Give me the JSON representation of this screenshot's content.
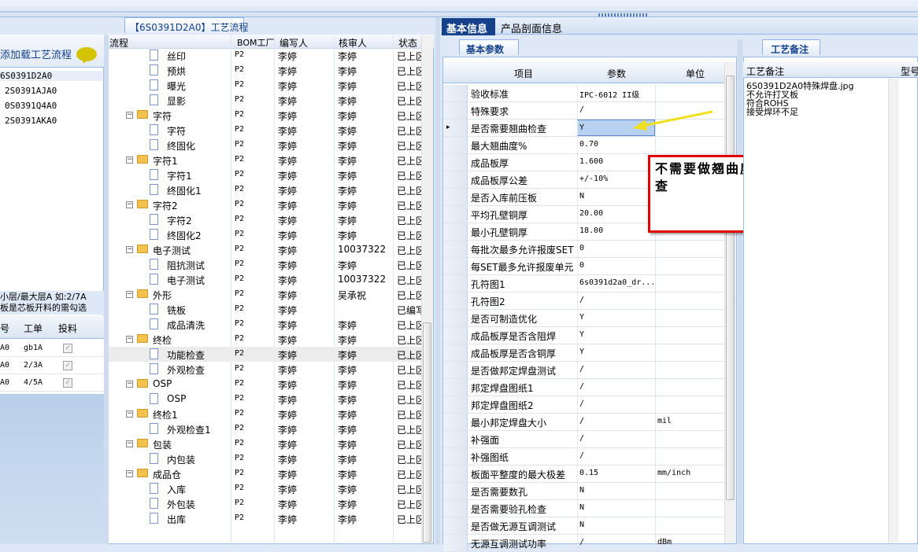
{
  "left": {
    "load_label": "添加载工艺流程",
    "orders": [
      "6S0391D2A0",
      "2S0391AJA0",
      "0S0391Q4A0",
      "2S0391AKA0"
    ],
    "hint_line1": "小层/最大层A 如:2/7A",
    "hint_line2": "板是芯板开料的需勾选",
    "grid_headers": [
      "号",
      "工单",
      "投料"
    ],
    "grid_rows": [
      {
        "no": "A0",
        "order": "gb1A",
        "checked": "✓"
      },
      {
        "no": "A0",
        "order": "2/3A",
        "checked": "✓"
      },
      {
        "no": "A0",
        "order": "4/5A",
        "checked": "✓"
      }
    ]
  },
  "middle": {
    "tab_label": "【6S0391D2A0】工艺流程",
    "headers": [
      "流程",
      "BOM工厂",
      "编写人",
      "核审人",
      "状态"
    ],
    "rows": [
      {
        "name": "丝印",
        "level": 2,
        "bom": "P2",
        "writer": "李婷",
        "reviewer": "李婷",
        "status": "已上区"
      },
      {
        "name": "预烘",
        "level": 2,
        "bom": "P2",
        "writer": "李婷",
        "reviewer": "李婷",
        "status": "已上区"
      },
      {
        "name": "曝光",
        "level": 2,
        "bom": "P2",
        "writer": "李婷",
        "reviewer": "李婷",
        "status": "已上区"
      },
      {
        "name": "显影",
        "level": 2,
        "bom": "P2",
        "writer": "李婷",
        "reviewer": "李婷",
        "status": "已上区"
      },
      {
        "name": "字符",
        "level": 1,
        "bom": "P2",
        "writer": "李婷",
        "reviewer": "李婷",
        "status": "已上区"
      },
      {
        "name": "字符",
        "level": 2,
        "bom": "P2",
        "writer": "李婷",
        "reviewer": "李婷",
        "status": "已上区"
      },
      {
        "name": "终固化",
        "level": 2,
        "bom": "P2",
        "writer": "李婷",
        "reviewer": "李婷",
        "status": "已上区"
      },
      {
        "name": "字符1",
        "level": 1,
        "bom": "P2",
        "writer": "李婷",
        "reviewer": "李婷",
        "status": "已上区"
      },
      {
        "name": "字符1",
        "level": 2,
        "bom": "P2",
        "writer": "李婷",
        "reviewer": "李婷",
        "status": "已上区"
      },
      {
        "name": "终固化1",
        "level": 2,
        "bom": "P2",
        "writer": "李婷",
        "reviewer": "李婷",
        "status": "已上区"
      },
      {
        "name": "字符2",
        "level": 1,
        "bom": "P2",
        "writer": "李婷",
        "reviewer": "李婷",
        "status": "已上区"
      },
      {
        "name": "字符2",
        "level": 2,
        "bom": "P2",
        "writer": "李婷",
        "reviewer": "李婷",
        "status": "已上区"
      },
      {
        "name": "终固化2",
        "level": 2,
        "bom": "P2",
        "writer": "李婷",
        "reviewer": "李婷",
        "status": "已上区"
      },
      {
        "name": "电子测试",
        "level": 1,
        "bom": "P2",
        "writer": "李婷",
        "reviewer": "10037322",
        "status": "已上区"
      },
      {
        "name": "阻抗测试",
        "level": 2,
        "bom": "P2",
        "writer": "李婷",
        "reviewer": "李婷",
        "status": "已上区"
      },
      {
        "name": "电子测试",
        "level": 2,
        "bom": "P2",
        "writer": "李婷",
        "reviewer": "10037322",
        "status": "已上区"
      },
      {
        "name": "外形",
        "level": 1,
        "bom": "P2",
        "writer": "李婷",
        "reviewer": "吴承祝",
        "status": "已上区"
      },
      {
        "name": "铣板",
        "level": 2,
        "bom": "P2",
        "writer": "李婷",
        "reviewer": "",
        "status": "已编写"
      },
      {
        "name": "成品清洗",
        "level": 2,
        "bom": "P2",
        "writer": "李婷",
        "reviewer": "李婷",
        "status": "已上区"
      },
      {
        "name": "终检",
        "level": 1,
        "bom": "P2",
        "writer": "李婷",
        "reviewer": "李婷",
        "status": "已上区"
      },
      {
        "name": "功能检查",
        "level": 2,
        "bom": "P2",
        "writer": "李婷",
        "reviewer": "李婷",
        "status": "已上区"
      },
      {
        "name": "外观检查",
        "level": 2,
        "bom": "P2",
        "writer": "李婷",
        "reviewer": "李婷",
        "status": "已上区"
      },
      {
        "name": "OSP",
        "level": 1,
        "bom": "P2",
        "writer": "李婷",
        "reviewer": "李婷",
        "status": "已上区"
      },
      {
        "name": "OSP",
        "level": 2,
        "bom": "P2",
        "writer": "李婷",
        "reviewer": "李婷",
        "status": "已上区"
      },
      {
        "name": "终检1",
        "level": 1,
        "bom": "P2",
        "writer": "李婷",
        "reviewer": "李婷",
        "status": "已上区"
      },
      {
        "name": "外观检查1",
        "level": 2,
        "bom": "P2",
        "writer": "李婷",
        "reviewer": "李婷",
        "status": "已上区"
      },
      {
        "name": "包装",
        "level": 1,
        "bom": "P2",
        "writer": "李婷",
        "reviewer": "李婷",
        "status": "已上区"
      },
      {
        "name": "内包装",
        "level": 2,
        "bom": "P2",
        "writer": "李婷",
        "reviewer": "李婷",
        "status": "已上区"
      },
      {
        "name": "成品仓",
        "level": 1,
        "bom": "P2",
        "writer": "李婷",
        "reviewer": "李婷",
        "status": "已上区"
      },
      {
        "name": "入库",
        "level": 2,
        "bom": "P2",
        "writer": "李婷",
        "reviewer": "李婷",
        "status": "已上区"
      },
      {
        "name": "外包装",
        "level": 2,
        "bom": "P2",
        "writer": "李婷",
        "reviewer": "李婷",
        "status": "已上区"
      },
      {
        "name": "出库",
        "level": 2,
        "bom": "P2",
        "writer": "李婷",
        "reviewer": "李婷",
        "status": "已上区"
      }
    ]
  },
  "right": {
    "tab_basic": "基本信息",
    "tab_section": "产品剖面信息",
    "subtab": "基本参数",
    "headers": [
      "项目",
      "参数",
      "单位"
    ],
    "rows": [
      {
        "key": "验收标准",
        "val": "IPC-6012 II级",
        "unit": ""
      },
      {
        "key": "特殊要求",
        "val": "/",
        "unit": ""
      },
      {
        "key": "是否需要翘曲检查",
        "val": "Y",
        "unit": ""
      },
      {
        "key": "最大翘曲度%",
        "val": "0.70",
        "unit": ""
      },
      {
        "key": "成品板厚",
        "val": "1.600",
        "unit": ""
      },
      {
        "key": "成品板厚公差",
        "val": "+/-10%",
        "unit": ""
      },
      {
        "key": "是否入库前压板",
        "val": "N",
        "unit": ""
      },
      {
        "key": "平均孔壁铜厚",
        "val": "20.00",
        "unit": ""
      },
      {
        "key": "最小孔壁铜厚",
        "val": "18.00",
        "unit": ""
      },
      {
        "key": "每批次最多允许报废SET",
        "val": "0",
        "unit": ""
      },
      {
        "key": "每SET最多允许报废单元",
        "val": "0",
        "unit": ""
      },
      {
        "key": "孔符图1",
        "val": "6s0391d2a0_dr...",
        "unit": ""
      },
      {
        "key": "孔符图2",
        "val": "/",
        "unit": ""
      },
      {
        "key": "是否可制造优化",
        "val": "Y",
        "unit": ""
      },
      {
        "key": "成品板厚是否含阻焊",
        "val": "Y",
        "unit": ""
      },
      {
        "key": "成品板厚是否含铜厚",
        "val": "Y",
        "unit": ""
      },
      {
        "key": "是否做邦定焊盘测试",
        "val": "/",
        "unit": ""
      },
      {
        "key": "邦定焊盘图纸1",
        "val": "/",
        "unit": ""
      },
      {
        "key": "邦定焊盘图纸2",
        "val": "/",
        "unit": ""
      },
      {
        "key": "最小邦定焊盘大小",
        "val": "/",
        "unit": "mil"
      },
      {
        "key": "补强面",
        "val": "/",
        "unit": ""
      },
      {
        "key": "补强图纸",
        "val": "/",
        "unit": ""
      },
      {
        "key": "板面平整度的最大极差",
        "val": "0.15",
        "unit": "mm/inch"
      },
      {
        "key": "是否需要数孔",
        "val": "N",
        "unit": ""
      },
      {
        "key": "是否需要验孔检查",
        "val": "N",
        "unit": ""
      },
      {
        "key": "是否做无源互调测试",
        "val": "N",
        "unit": ""
      },
      {
        "key": "无源互调测试功率",
        "val": "/",
        "unit": "dBm"
      }
    ],
    "annotation": "不需要做翘曲度检查",
    "annotation_color": "#e00000",
    "arrow_color": "#f0e020"
  },
  "notes": {
    "tab": "工艺备注",
    "header": "工艺备注",
    "header2": "型号",
    "lines": [
      "6S0391D2A0特殊焊盘.jpg",
      "不允许打叉板",
      "符合ROHS",
      "接受焊环不足"
    ]
  }
}
